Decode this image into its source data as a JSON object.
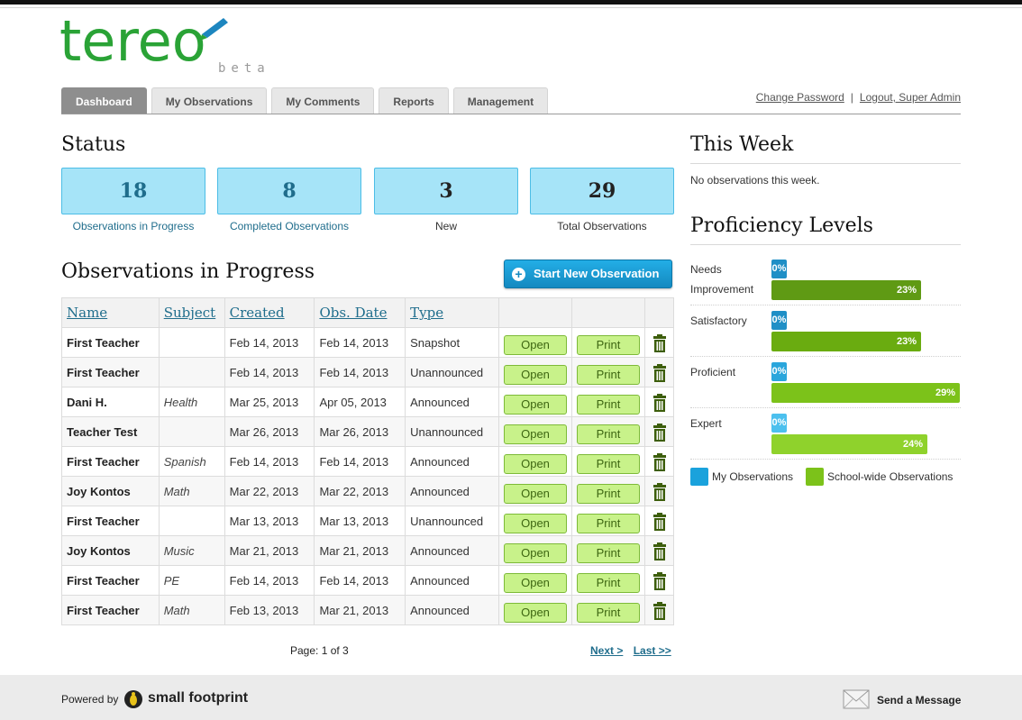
{
  "brand": {
    "logo_main": "tereo",
    "logo_beta": "beta",
    "colors": {
      "green": "#2aa336",
      "blue": "#1d86bf",
      "accent_bar": "#6aaa12"
    }
  },
  "nav": {
    "tabs": [
      {
        "label": "Dashboard",
        "active": true
      },
      {
        "label": "My Observations",
        "active": false
      },
      {
        "label": "My Comments",
        "active": false
      },
      {
        "label": "Reports",
        "active": false
      },
      {
        "label": "Management",
        "active": false
      }
    ],
    "change_password": "Change Password",
    "separator": "|",
    "logout": "Logout, Super Admin"
  },
  "status": {
    "title": "Status",
    "boxes": [
      {
        "value": "18",
        "label": "Observations in Progress"
      },
      {
        "value": "8",
        "label": "Completed Observations"
      },
      {
        "value": "3",
        "label": "New"
      },
      {
        "value": "29",
        "label": "Total Observations"
      }
    ]
  },
  "observations": {
    "title": "Observations in Progress",
    "start_button": "Start New Observation",
    "columns": [
      "Name",
      "Subject",
      "Created",
      "Obs. Date",
      "Type"
    ],
    "open_label": "Open",
    "print_label": "Print",
    "rows": [
      {
        "name": "First Teacher",
        "subject": "",
        "created": "Feb 14, 2013",
        "obs_date": "Feb 14, 2013",
        "type": "Snapshot"
      },
      {
        "name": "First Teacher",
        "subject": "",
        "created": "Feb 14, 2013",
        "obs_date": "Feb 14, 2013",
        "type": "Unannounced"
      },
      {
        "name": "Dani H.",
        "subject": "Health",
        "created": "Mar 25, 2013",
        "obs_date": "Apr 05, 2013",
        "type": "Announced"
      },
      {
        "name": "Teacher Test",
        "subject": "",
        "created": "Mar 26, 2013",
        "obs_date": "Mar 26, 2013",
        "type": "Unannounced"
      },
      {
        "name": "First Teacher",
        "subject": "Spanish",
        "created": "Feb 14, 2013",
        "obs_date": "Feb 14, 2013",
        "type": "Announced"
      },
      {
        "name": "Joy Kontos",
        "subject": "Math",
        "created": "Mar 22, 2013",
        "obs_date": "Mar 22, 2013",
        "type": "Announced"
      },
      {
        "name": "First Teacher",
        "subject": "",
        "created": "Mar 13, 2013",
        "obs_date": "Mar 13, 2013",
        "type": "Unannounced"
      },
      {
        "name": "Joy Kontos",
        "subject": "Music",
        "created": "Mar 21, 2013",
        "obs_date": "Mar 21, 2013",
        "type": "Announced"
      },
      {
        "name": "First Teacher",
        "subject": "PE",
        "created": "Feb 14, 2013",
        "obs_date": "Feb 14, 2013",
        "type": "Announced"
      },
      {
        "name": "First Teacher",
        "subject": "Math",
        "created": "Feb 13, 2013",
        "obs_date": "Mar 21, 2013",
        "type": "Announced"
      }
    ],
    "pager": {
      "page_text": "Page: 1 of 3",
      "next": "Next >",
      "last": "Last >>"
    }
  },
  "this_week": {
    "title": "This Week",
    "message": "No observations this week."
  },
  "proficiency": {
    "title": "Proficiency Levels",
    "levels": [
      {
        "label_line1": "Needs",
        "label_line2": "Improvement",
        "mine_pct": 0,
        "mine_label": "0%",
        "school_pct": 23,
        "school_label": "23%",
        "school_color": "#5f9a14",
        "mine_color": "#1f8fc6"
      },
      {
        "label_line1": "Satisfactory",
        "label_line2": "",
        "mine_pct": 0,
        "mine_label": "0%",
        "school_pct": 23,
        "school_label": "23%",
        "school_color": "#6aac10",
        "mine_color": "#1f8fc6"
      },
      {
        "label_line1": "Proficient",
        "label_line2": "",
        "mine_pct": 0,
        "mine_label": "0%",
        "school_pct": 29,
        "school_label": "29%",
        "school_color": "#7cc21a",
        "mine_color": "#2aa6dc"
      },
      {
        "label_line1": "Expert",
        "label_line2": "",
        "mine_pct": 0,
        "mine_label": "0%",
        "school_pct": 24,
        "school_label": "24%",
        "school_color": "#8fd22c",
        "mine_color": "#4cc0ee"
      }
    ],
    "legend": [
      {
        "label": "My Observations",
        "color": "#1aa2dc"
      },
      {
        "label": "School-wide Observations",
        "color": "#7cc21a"
      }
    ]
  },
  "footer": {
    "powered_by": "Powered by",
    "company": "small footprint",
    "send_message": "Send a Message"
  }
}
